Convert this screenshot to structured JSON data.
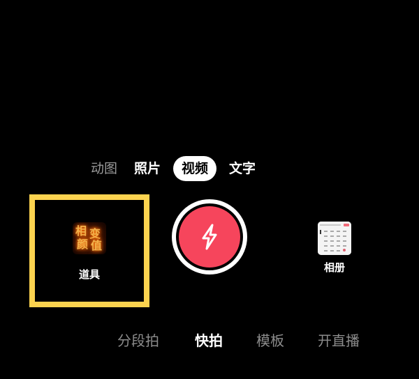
{
  "mode_tabs": {
    "items": [
      "动图",
      "照片",
      "视频",
      "文字"
    ],
    "active_index": 2
  },
  "props": {
    "label": "道具",
    "thumb_text": [
      "相",
      "变",
      "颜",
      "值"
    ]
  },
  "shutter": {
    "icon": "lightning-icon",
    "color": "#f6455c"
  },
  "album": {
    "label": "相册"
  },
  "bottom_modes": {
    "items": [
      "分段拍",
      "快拍",
      "模板",
      "开直播"
    ],
    "active_index": 1
  },
  "colors": {
    "highlight_border": "#fcd34f",
    "background": "#000000"
  }
}
